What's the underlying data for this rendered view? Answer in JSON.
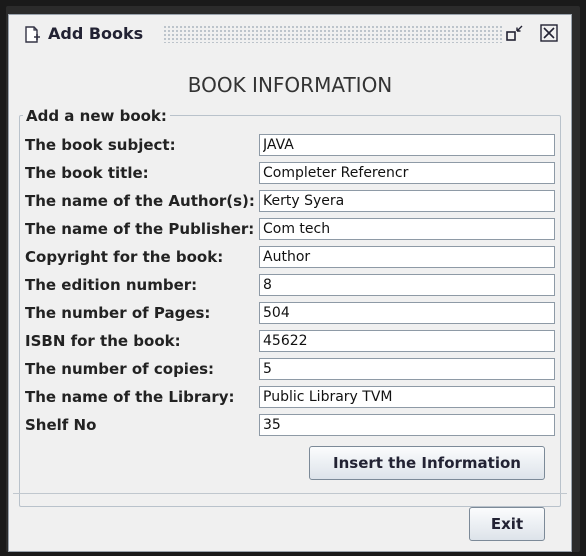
{
  "window": {
    "title": "Add Books",
    "icon": "add-document-icon",
    "restore_icon": "restore-icon",
    "close_icon": "close-icon"
  },
  "heading": "BOOK INFORMATION",
  "group_label": "Add a new book:",
  "fields": [
    {
      "label": "The book subject:",
      "value": "JAVA"
    },
    {
      "label": "The book title:",
      "value": "Completer Referencr"
    },
    {
      "label": "The name of the Author(s):",
      "value": "Kerty Syera"
    },
    {
      "label": "The name of the Publisher:",
      "value": "Com tech"
    },
    {
      "label": "Copyright for the book:",
      "value": "Author"
    },
    {
      "label": "The edition number:",
      "value": "8"
    },
    {
      "label": "The number of Pages:",
      "value": "504"
    },
    {
      "label": "ISBN for the book:",
      "value": "45622"
    },
    {
      "label": "The number of copies:",
      "value": "5"
    },
    {
      "label": "The name of the Library:",
      "value": "Public Library TVM"
    },
    {
      "label": "Shelf No",
      "value": "35"
    }
  ],
  "buttons": {
    "insert": "Insert the Information",
    "exit": "Exit"
  }
}
